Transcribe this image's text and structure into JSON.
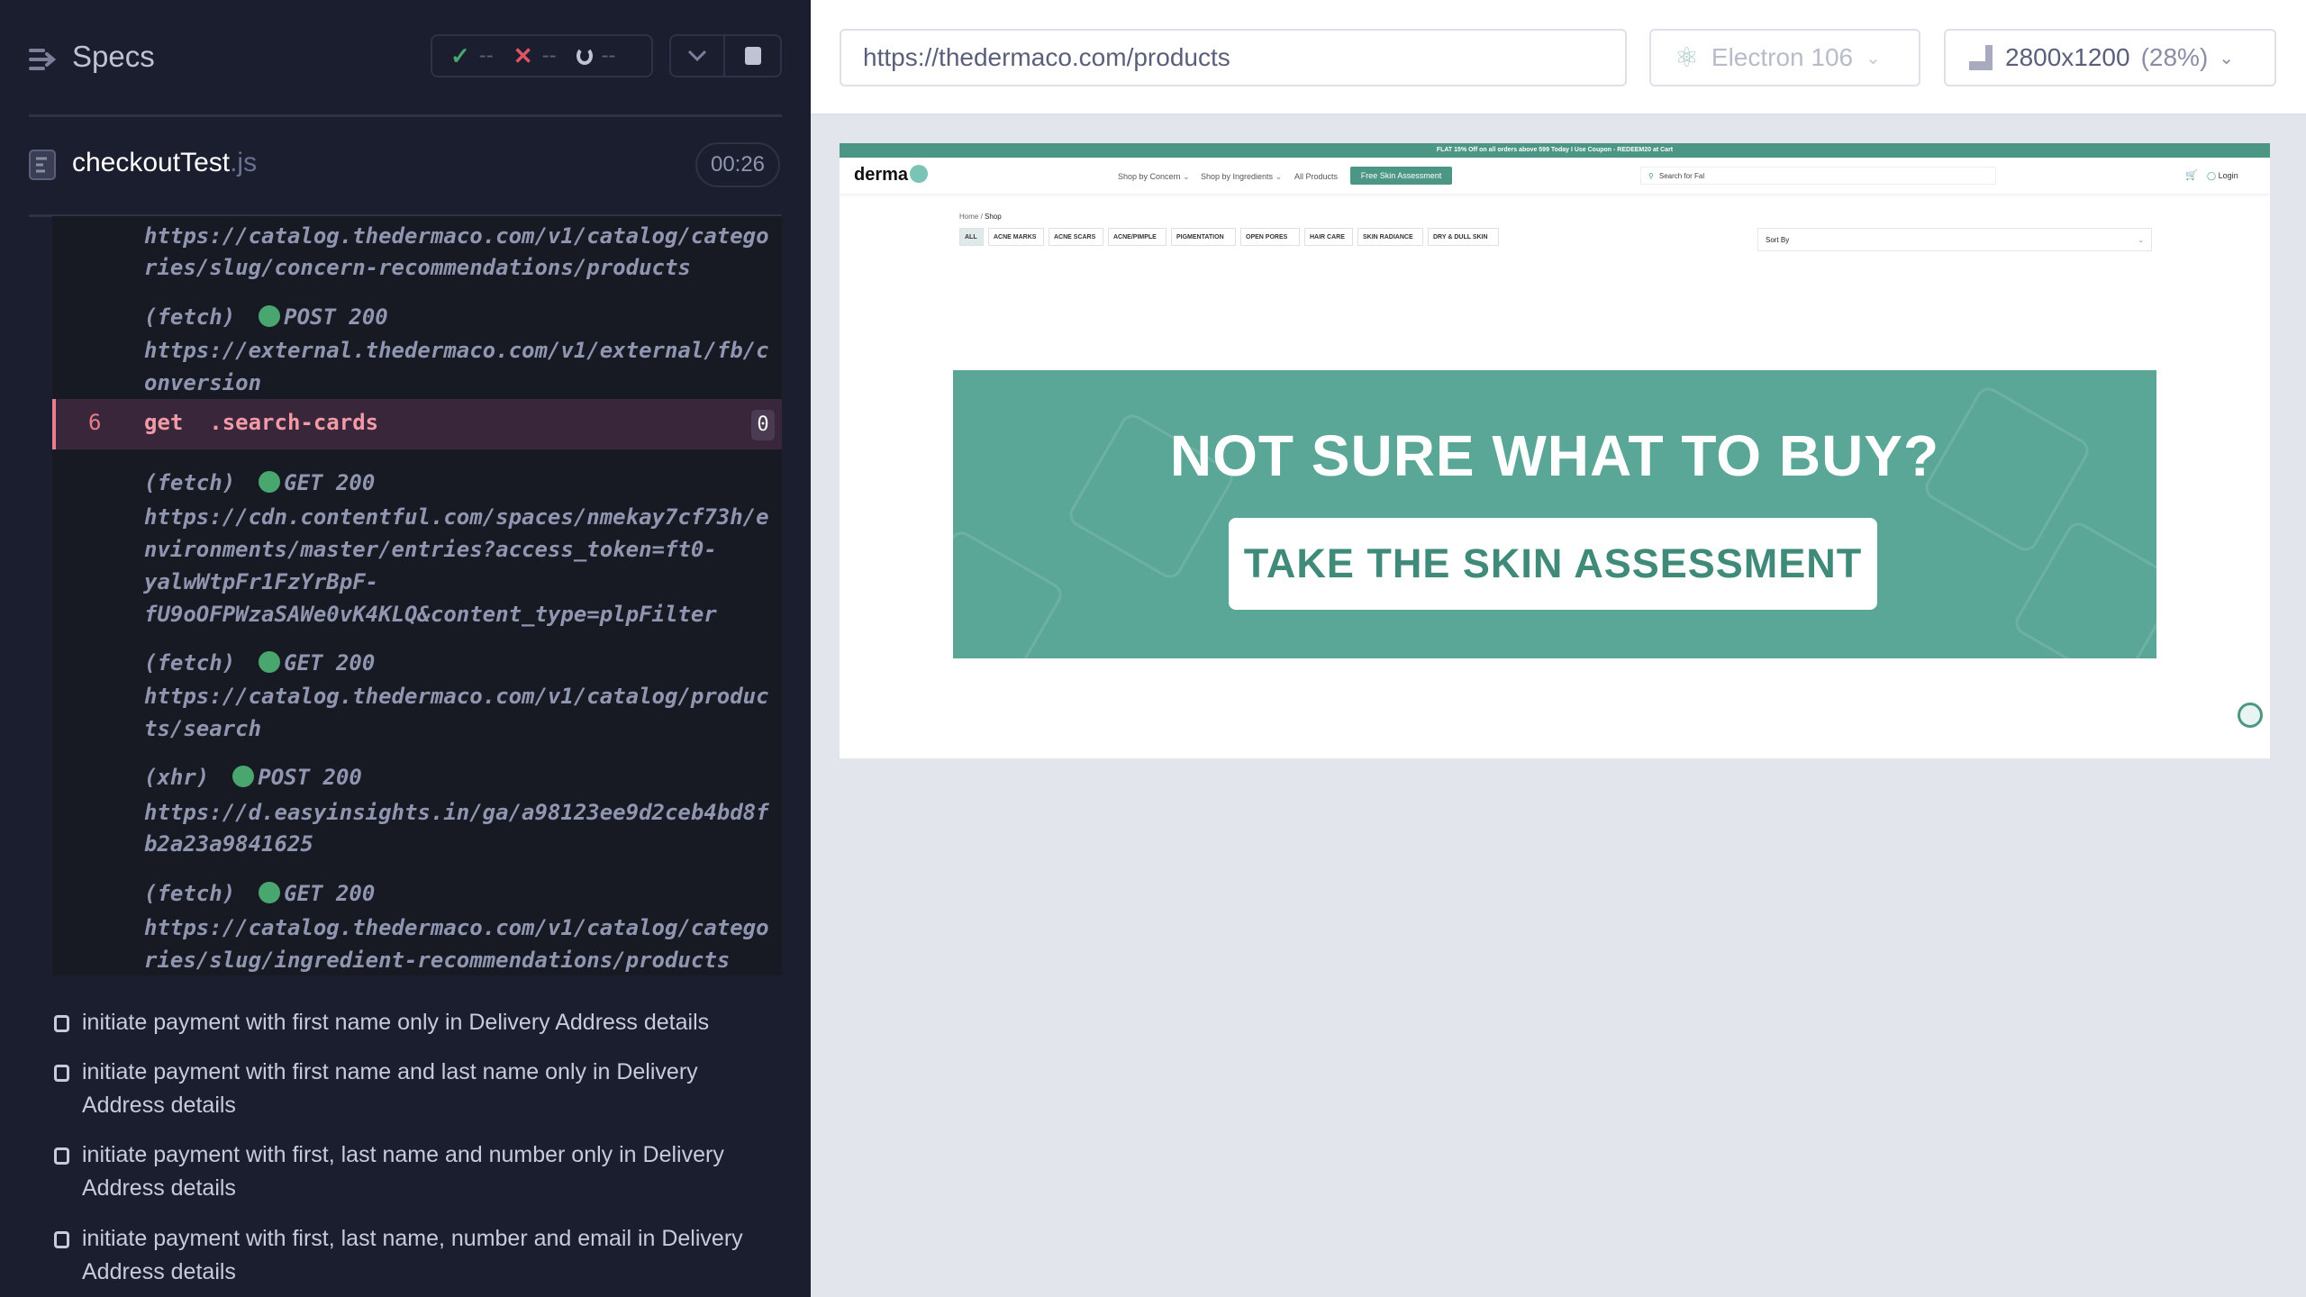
{
  "sidebar": {
    "title": "Specs",
    "stats": {
      "passed": "--",
      "failed": "--",
      "pending": "--"
    },
    "spec": {
      "name": "checkoutTest",
      "ext": ".js",
      "duration": "00:26"
    },
    "log": [
      {
        "kind": "url",
        "text": "https://catalog.thedermaco.com/v1/catalog/catego"
      },
      {
        "kind": "url",
        "text": "ries/slug/concern-recommendations/products"
      },
      {
        "kind": "req",
        "type": "(fetch)",
        "method": "POST 200"
      },
      {
        "kind": "url",
        "text": "https://external.thedermaco.com/v1/external/fb/c"
      },
      {
        "kind": "url",
        "text": "onversion"
      },
      {
        "kind": "req",
        "type": "(fetch)",
        "method": "GET 200"
      },
      {
        "kind": "url",
        "text": "https://cdn.contentful.com/spaces/nmekay7cf73h/e"
      },
      {
        "kind": "url",
        "text": "nvironments/master/entries?access_token=ft0-"
      },
      {
        "kind": "url",
        "text": "yalwWtpFr1FzYrBpF-"
      },
      {
        "kind": "url",
        "text": "fU9oOFPWzaSAWe0vK4KLQ&content_type=plpFilter"
      },
      {
        "kind": "req",
        "type": "(fetch)",
        "method": "GET 200"
      },
      {
        "kind": "url",
        "text": "https://catalog.thedermaco.com/v1/catalog/produc"
      },
      {
        "kind": "url",
        "text": "ts/search"
      },
      {
        "kind": "req",
        "type": "(xhr)",
        "method": "POST 200"
      },
      {
        "kind": "url",
        "text": "https://d.easyinsights.in/ga/a98123ee9d2ceb4bd8f"
      },
      {
        "kind": "url",
        "text": "b2a23a9841625"
      },
      {
        "kind": "req",
        "type": "(fetch)",
        "method": "GET 200"
      },
      {
        "kind": "url",
        "text": "https://catalog.thedermaco.com/v1/catalog/catego"
      },
      {
        "kind": "url",
        "text": "ries/slug/ingredient-recommendations/products"
      }
    ],
    "active_command": {
      "number": "6",
      "command": "get  .search-cards",
      "count": "0"
    },
    "tests": [
      "initiate payment with first name only in Delivery Address details",
      "initiate payment with first name and last name only in Delivery Address details",
      "initiate payment with first, last name and number only in Delivery Address details",
      "initiate payment with first, last name, number and email in Delivery Address details"
    ]
  },
  "toolbar": {
    "url": "https://thedermaco.com/products",
    "browser": "Electron 106",
    "viewport": "2800x1200",
    "zoom": "(28%)"
  },
  "site": {
    "announcement": "FLAT 15% Off on all orders above 599 Today I Use Coupon - REDEEM20 at Cart",
    "logo": "THE derma co",
    "nav": [
      "Shop by Concern",
      "Shop by Ingredients",
      "All Products"
    ],
    "cta": "Free Skin Assessment",
    "search_placeholder": "Search for Fal",
    "login": "Login",
    "breadcrumb_home": "Home",
    "breadcrumb_current": "Shop",
    "chips": [
      "ALL",
      "ACNE MARKS",
      "ACNE SCARS",
      "ACNE/PIMPLE",
      "PIGMENTATION",
      "OPEN PORES",
      "HAIR CARE",
      "SKIN RADIANCE",
      "DRY & DULL SKIN"
    ],
    "sort": "Sort By",
    "banner_title": "NOT SURE WHAT TO BUY?",
    "banner_button": "TAKE THE SKIN ASSESSMENT"
  },
  "colors": {
    "brand": "#4b9684",
    "pass": "#4aa66f",
    "fail": "#e05562",
    "active": "#e87d8d"
  }
}
